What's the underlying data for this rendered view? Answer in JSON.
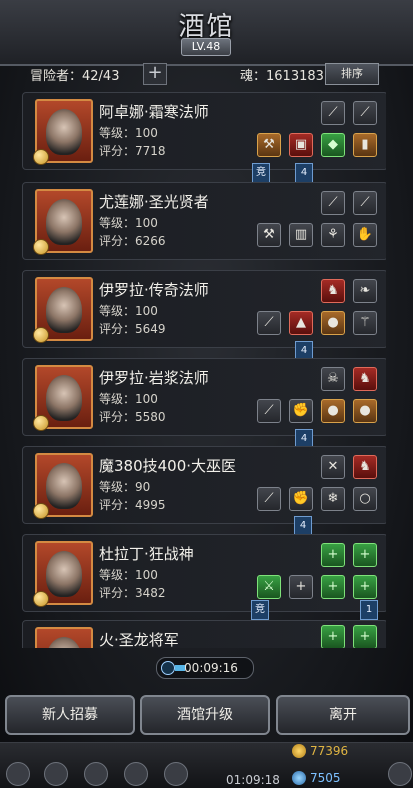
{
  "header": {
    "title": "酒馆",
    "level": "LV.48"
  },
  "stats": {
    "adventurers": "冒险者：42/43",
    "soul": "魂：1613183",
    "sort_label": "排序",
    "add_label": "+"
  },
  "cards": [
    {
      "name": "阿卓娜·霜寒法师",
      "level": "等级：100",
      "score": "评分：7718",
      "tags": [
        "竞",
        "4"
      ]
    },
    {
      "name": "尤莲娜·圣光贤者",
      "level": "等级：100",
      "score": "评分：6266",
      "tags": []
    },
    {
      "name": "伊罗拉·传奇法师",
      "level": "等级：100",
      "score": "评分：5649",
      "tags": [
        "4"
      ]
    },
    {
      "name": "伊罗拉·岩浆法师",
      "level": "等级：100",
      "score": "评分：5580",
      "tags": [
        "4"
      ]
    },
    {
      "name": "魔380技400·大巫医",
      "level": "等级：90",
      "score": "评分：4995",
      "tags": [
        "4"
      ]
    },
    {
      "name": "杜拉丁·狂战神",
      "level": "等级：100",
      "score": "评分：3482",
      "tags": [
        "竞",
        "1"
      ]
    },
    {
      "name": "火·圣龙将军",
      "level": "",
      "score": "",
      "tags": []
    }
  ],
  "timer": "00:09:16",
  "buttons": {
    "recruit": "新人招募",
    "upgrade": "酒馆升级",
    "leave": "离开"
  },
  "footer": {
    "timer2": "01:09:18",
    "gold": "77396",
    "gems": "7505"
  }
}
